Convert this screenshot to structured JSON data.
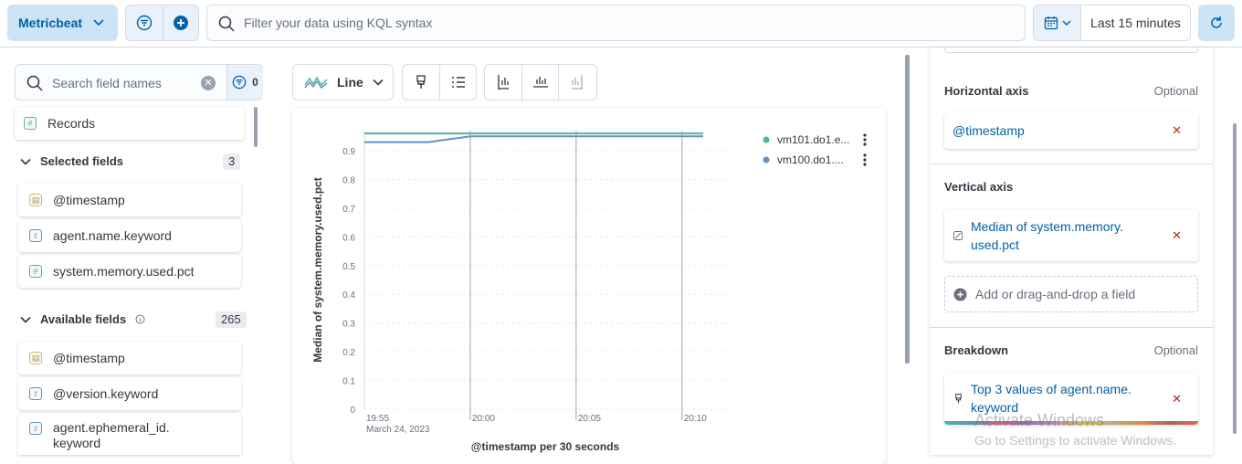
{
  "topbar": {
    "dataview_label": "Metricbeat",
    "kql_placeholder": "Filter your data using KQL syntax",
    "time_label": "Last 15 minutes"
  },
  "left": {
    "search_placeholder": "Search field names",
    "filter_count": "0",
    "records_label": "Records",
    "selected_title": "Selected fields",
    "selected_count": "3",
    "selected_fields": [
      "@timestamp",
      "agent.name.keyword",
      "system.memory.used.pct"
    ],
    "available_title": "Available fields",
    "available_count": "265",
    "available_fields": [
      "@timestamp",
      "@version.keyword",
      "agent.ephemeral_id.",
      "keyword"
    ]
  },
  "middle": {
    "chart_type_label": "Line"
  },
  "chart_data": {
    "type": "line",
    "ylabel": "Median of system.memory.used.pct",
    "xlabel": "@timestamp per 30 seconds",
    "x_ticks": [
      "19:55",
      "20:00",
      "20:05",
      "20:10"
    ],
    "x_subtick": "March 24, 2023",
    "y_ticks": [
      "0",
      "0.1",
      "0.2",
      "0.3",
      "0.4",
      "0.5",
      "0.6",
      "0.7",
      "0.8",
      "0.9"
    ],
    "ylim": [
      0,
      0.97
    ],
    "x": [
      "19:55",
      "19:58",
      "20:00",
      "20:05",
      "20:10",
      "20:11"
    ],
    "series": [
      {
        "name": "vm101.do1.e...",
        "color": "#54b399",
        "values": [
          0.96,
          0.96,
          0.96,
          0.96,
          0.96,
          0.96
        ]
      },
      {
        "name": "vm100.do1....",
        "color": "#6092c0",
        "values": [
          0.93,
          0.93,
          0.95,
          0.95,
          0.95,
          0.95
        ]
      }
    ],
    "legend": "top-right",
    "grid": true
  },
  "right": {
    "h_axis_title": "Horizontal axis",
    "h_axis_optional": "Optional",
    "h_axis_field": "@timestamp",
    "v_axis_title": "Vertical axis",
    "v_axis_field_1": "Median of system.memory.",
    "v_axis_field_2": "used.pct",
    "add_field": "Add or drag-and-drop a field",
    "breakdown_title": "Breakdown",
    "breakdown_optional": "Optional",
    "breakdown_field_1": "Top 3 values of agent.name.",
    "breakdown_field_2": "keyword"
  },
  "watermark": {
    "line1": "Activate Windows",
    "line2": "Go to Settings to activate Windows."
  }
}
